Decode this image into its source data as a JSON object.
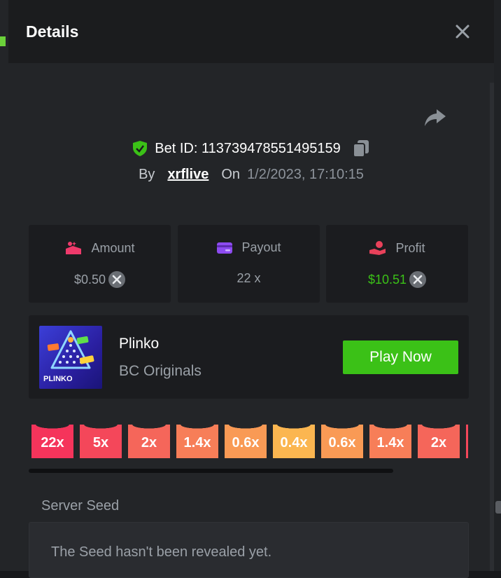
{
  "header": {
    "title": "Details"
  },
  "bet": {
    "id_text": "Bet ID: 113739478551495159",
    "by_label": "By",
    "username": "xrflive",
    "on_label": "On",
    "datetime": "1/2/2023, 17:10:15"
  },
  "stats": {
    "amount": {
      "label": "Amount",
      "value": "$0.50"
    },
    "payout": {
      "label": "Payout",
      "value": "22 x"
    },
    "profit": {
      "label": "Profit",
      "value": "$10.51"
    }
  },
  "game": {
    "name": "Plinko",
    "provider": "BC Originals",
    "thumb_label": "PLINKO",
    "play_label": "Play Now"
  },
  "buckets": [
    {
      "label": "22x",
      "color": "#f5345b"
    },
    {
      "label": "5x",
      "color": "#f4475a"
    },
    {
      "label": "2x",
      "color": "#f5665a"
    },
    {
      "label": "1.4x",
      "color": "#f77e58"
    },
    {
      "label": "0.6x",
      "color": "#f99a55"
    },
    {
      "label": "0.4x",
      "color": "#fbb650"
    },
    {
      "label": "0.6x",
      "color": "#f99a55"
    },
    {
      "label": "1.4x",
      "color": "#f77e58"
    },
    {
      "label": "2x",
      "color": "#f5665a"
    },
    {
      "label": "",
      "color": "#f4475a"
    }
  ],
  "seed": {
    "label": "Server Seed",
    "text": "The Seed hasn't been revealed yet."
  },
  "colors": {
    "accent_green": "#3bc117",
    "amount_icon": "#ee3a6b",
    "payout_icon": "#8d4bf0",
    "profit_icon": "#e8415a"
  }
}
